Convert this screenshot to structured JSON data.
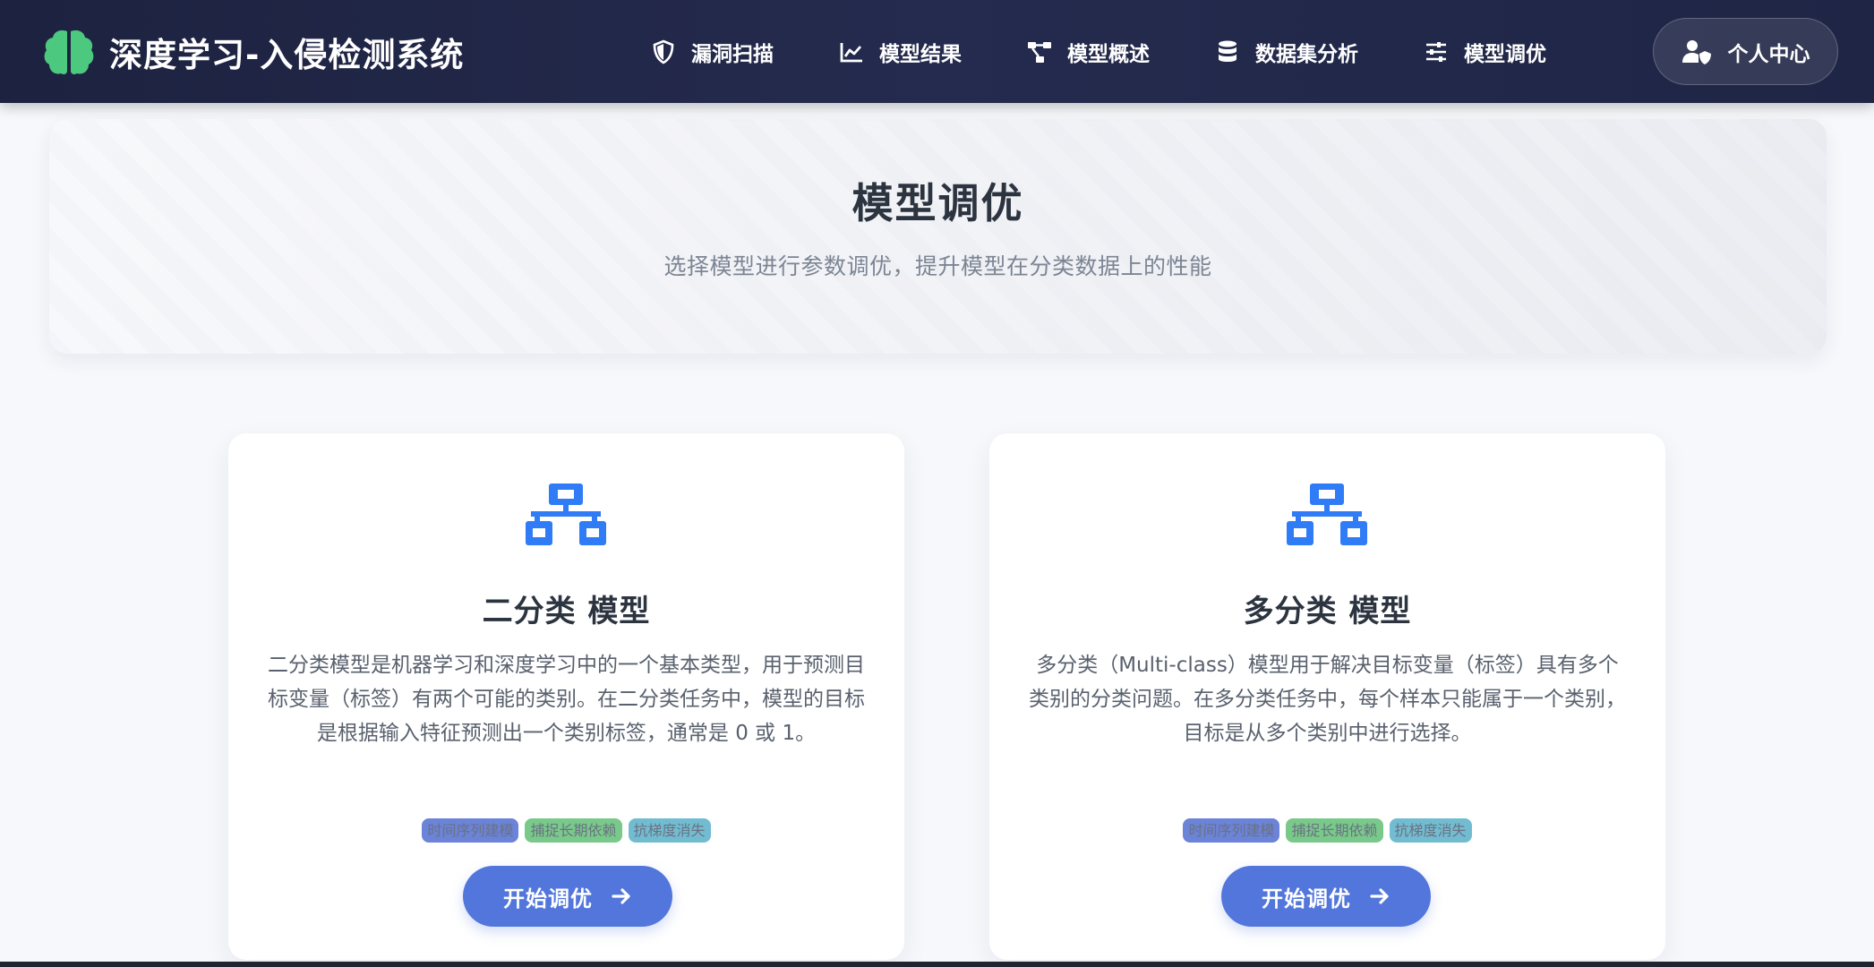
{
  "header": {
    "title": "深度学习-入侵检测系统",
    "logo_icon": "brain-icon",
    "nav": [
      {
        "label": "漏洞扫描",
        "icon": "shield-icon"
      },
      {
        "label": "模型结果",
        "icon": "line-chart-icon"
      },
      {
        "label": "模型概述",
        "icon": "project-diagram-icon"
      },
      {
        "label": "数据集分析",
        "icon": "database-icon"
      },
      {
        "label": "模型调优",
        "icon": "sliders-icon"
      }
    ],
    "user_button": {
      "label": "个人中心",
      "icon": "user-shield-icon"
    }
  },
  "hero": {
    "title": "模型调优",
    "subtitle": "选择模型进行参数调优，提升模型在分类数据上的性能"
  },
  "cards": [
    {
      "icon": "sitemap-icon",
      "title": "二分类 模型",
      "description": "二分类模型是机器学习和深度学习中的一个基本类型，用于预测目标变量（标签）有两个可能的类别。在二分类任务中，模型的目标是根据输入特征预测出一个类别标签，通常是 0 或 1。",
      "tags": [
        "时间序列建模",
        "捕捉长期依赖",
        "抗梯度消失"
      ],
      "button": "开始调优"
    },
    {
      "icon": "sitemap-icon",
      "title": "多分类 模型",
      "description": "多分类（Multi-class）模型用于解决目标变量（标签）具有多个类别的分类问题。在多分类任务中，每个样本只能属于一个类别，目标是从多个类别中进行选择。",
      "tags": [
        "时间序列建模",
        "捕捉长期依赖",
        "抗梯度消失"
      ],
      "button": "开始调优"
    }
  ],
  "colors": {
    "navbar": "#1d2240",
    "accent": "#5276dc",
    "icon_blue": "#2f7cf6",
    "logo_green": "#4cc97e",
    "tag_blue": "#6b83d8",
    "tag_green": "#79c98a",
    "tag_teal": "#72bcd1"
  }
}
